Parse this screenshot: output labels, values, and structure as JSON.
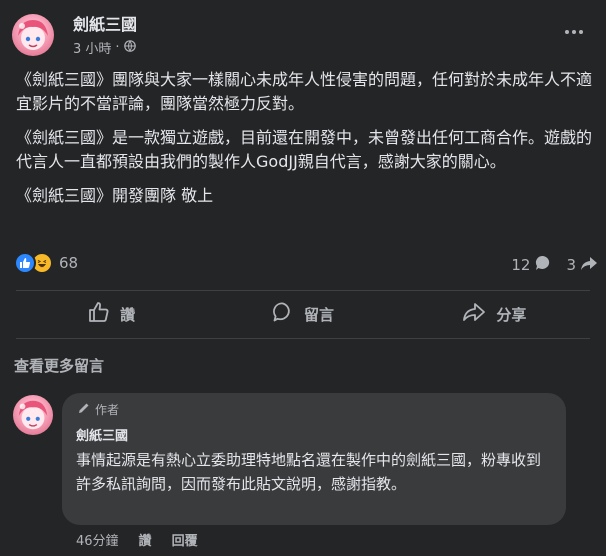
{
  "post": {
    "page_name": "劍紙三國",
    "time": "3 小時",
    "privacy_icon": "globe-icon",
    "more_icon": "ellipsis-icon",
    "paragraphs": [
      "《劍紙三國》團隊與大家一樣關心未成年人性侵害的問題，任何對於未成年人不適宜影片的不當評論，團隊當然極力反對。",
      "《劍紙三國》是一款獨立遊戲，目前還在開發中，未曾發出任何工商合作。遊戲的代言人一直都預設由我們的製作人GodJJ親自代言，感謝大家的關心。",
      "《劍紙三國》開發團隊 敬上"
    ]
  },
  "stats": {
    "reaction_icons": [
      "like-icon",
      "haha-icon"
    ],
    "reaction_count": "68",
    "comment_count": "12",
    "share_count": "3"
  },
  "actions": {
    "like": "讚",
    "comment": "留言",
    "share": "分享"
  },
  "comments": {
    "more_label": "查看更多留言",
    "items": [
      {
        "badge": "作者",
        "name": "劍紙三國",
        "text": "事情起源是有熱心立委助理特地點名還在製作中的劍紙三國，粉專收到許多私訊詢問，因而發布此貼文說明，感謝指教。",
        "time": "46分鐘",
        "like": "讚",
        "reply": "回覆"
      }
    ]
  },
  "colors": {
    "background": "#242526",
    "bubble": "#3a3b3c",
    "text_primary": "#e4e6eb",
    "text_secondary": "#b0b3b8",
    "like_blue": "#2d88ff",
    "haha_yellow": "#f7b928"
  }
}
